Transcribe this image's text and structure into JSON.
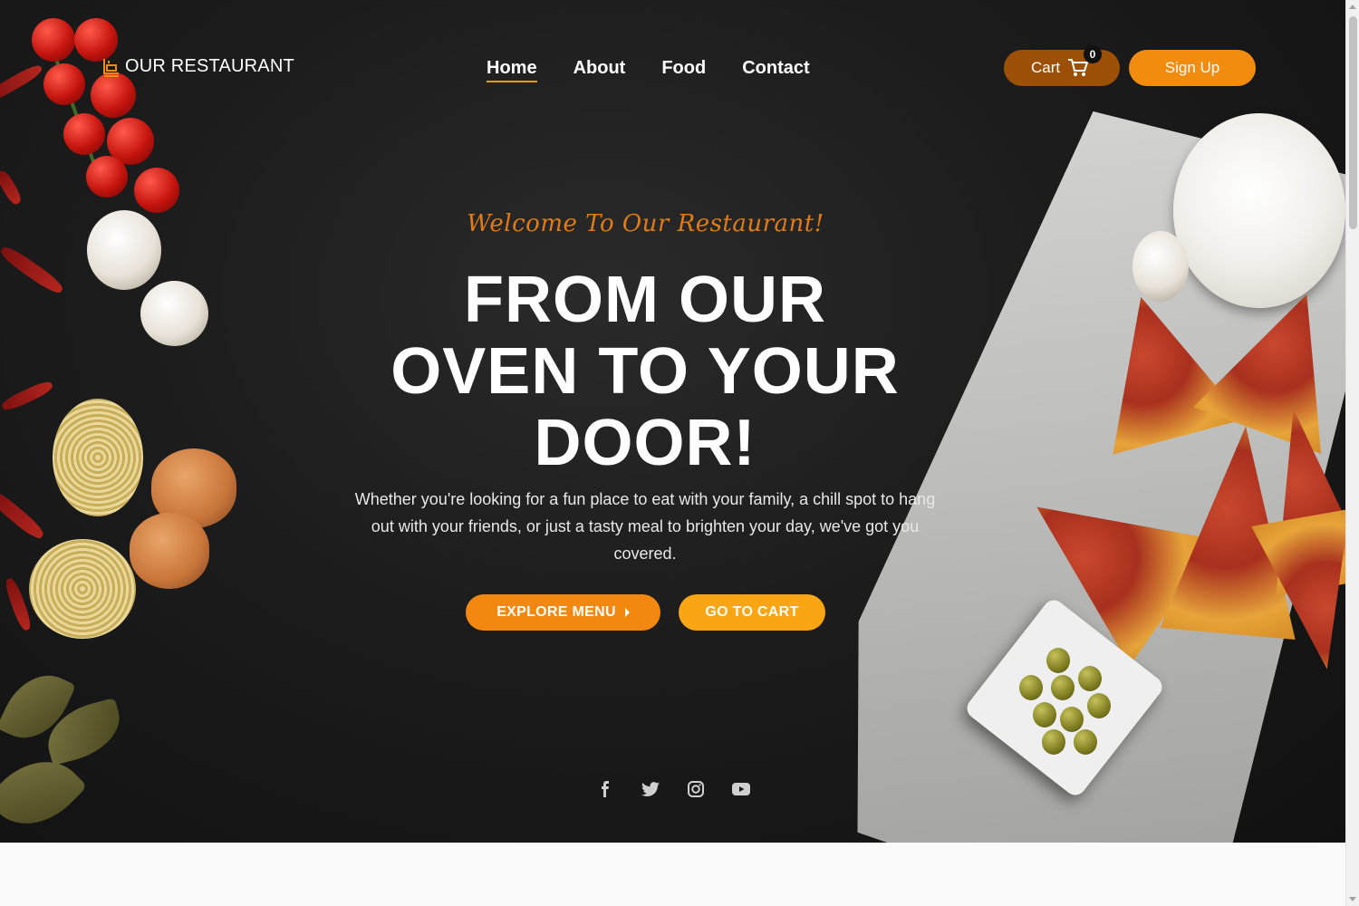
{
  "brand": {
    "name": "OUR RESTAURANT",
    "logo_icon": "chef-stove-icon",
    "accent_color": "#f28c0f"
  },
  "nav": {
    "items": [
      {
        "label": "Home",
        "active": true
      },
      {
        "label": "About",
        "active": false
      },
      {
        "label": "Food",
        "active": false
      },
      {
        "label": "Contact",
        "active": false
      }
    ]
  },
  "header_actions": {
    "cart_label": "Cart",
    "cart_count": "0",
    "signup_label": "Sign Up"
  },
  "hero": {
    "welcome": "Welcome To Our Restaurant!",
    "headline_line1": "FROM OUR",
    "headline_line2": "OVEN TO YOUR",
    "headline_line3": "DOOR!",
    "subtext": "Whether you're looking for a fun place to eat with your family, a chill spot to hang out with your friends, or just a tasty meal to brighten your day, we've got you covered.",
    "primary_button": "EXPLORE MENU",
    "secondary_button": "GO TO CART"
  },
  "socials": [
    "facebook-icon",
    "twitter-icon",
    "instagram-icon",
    "youtube-icon"
  ]
}
